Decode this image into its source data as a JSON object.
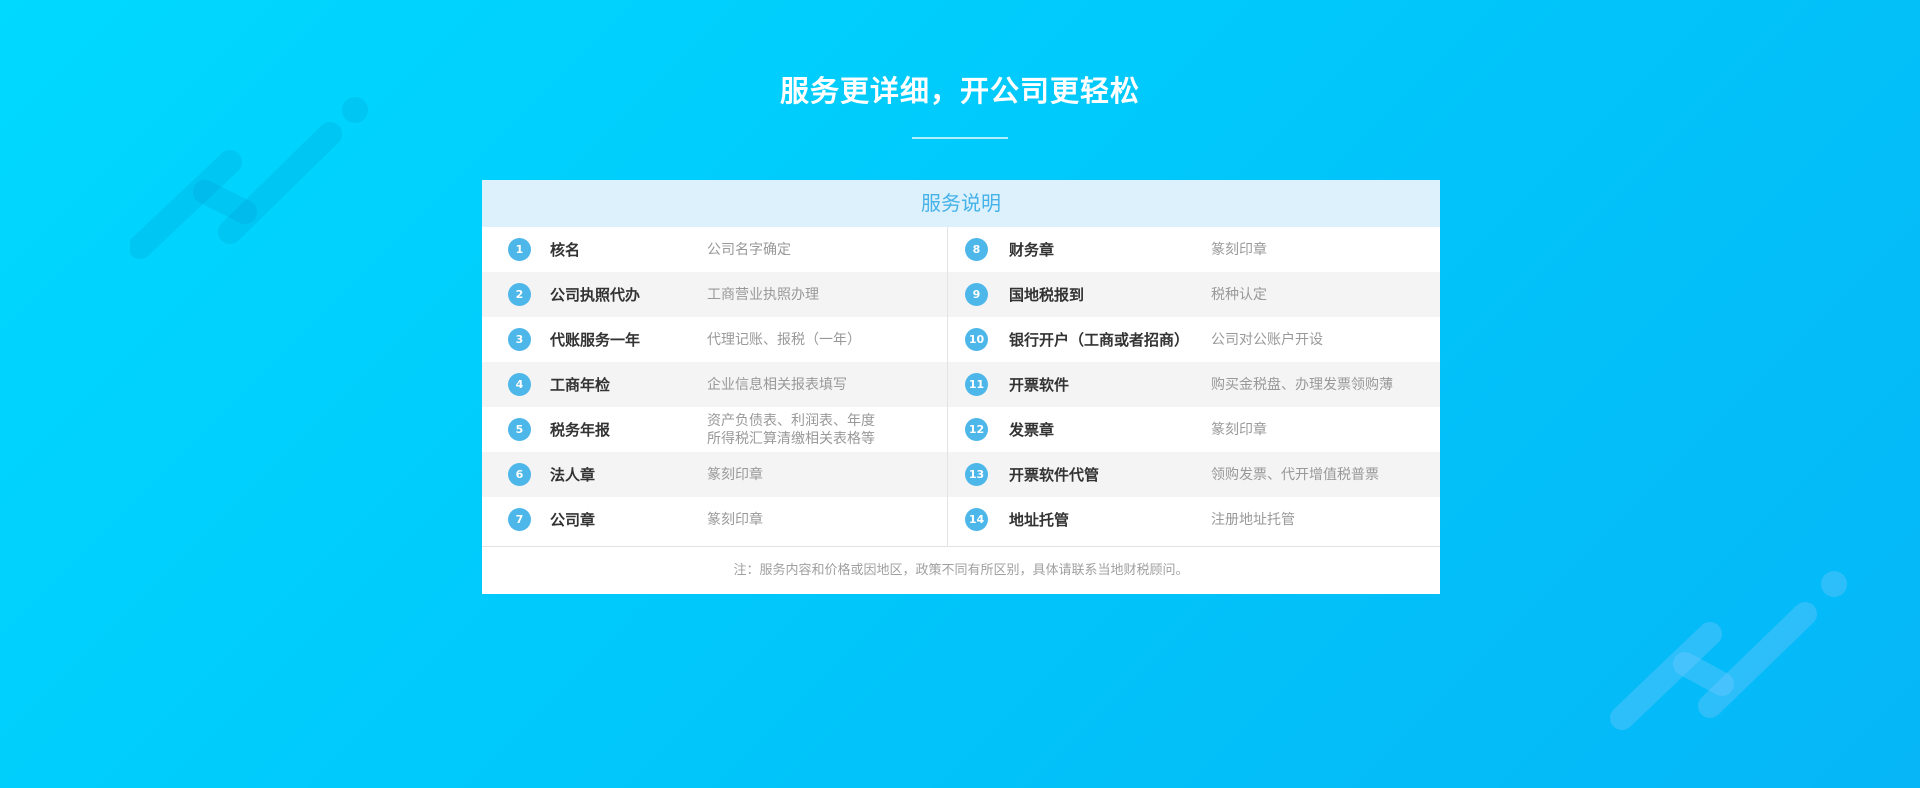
{
  "page": {
    "title": "服务更详细，开公司更轻松"
  },
  "card": {
    "header": "服务说明",
    "footnote": "注：服务内容和价格或因地区，政策不同有所区别，具体请联系当地财税顾问。",
    "left_items": [
      {
        "num": "1",
        "name": "核名",
        "desc": [
          "公司名字确定"
        ]
      },
      {
        "num": "2",
        "name": "公司执照代办",
        "desc": [
          "工商营业执照办理"
        ]
      },
      {
        "num": "3",
        "name": "代账服务一年",
        "desc": [
          "代理记账、报税（一年）"
        ]
      },
      {
        "num": "4",
        "name": "工商年检",
        "desc": [
          "企业信息相关报表填写"
        ]
      },
      {
        "num": "5",
        "name": "税务年报",
        "desc": [
          "资产负债表、利润表、年度",
          "所得税汇算清缴相关表格等"
        ]
      },
      {
        "num": "6",
        "name": "法人章",
        "desc": [
          "篆刻印章"
        ]
      },
      {
        "num": "7",
        "name": "公司章",
        "desc": [
          "篆刻印章"
        ]
      }
    ],
    "right_items": [
      {
        "num": "8",
        "name": "财务章",
        "desc": [
          "篆刻印章"
        ]
      },
      {
        "num": "9",
        "name": "国地税报到",
        "desc": [
          "税种认定"
        ]
      },
      {
        "num": "10",
        "name": "银行开户（工商或者招商）",
        "desc": [
          "公司对公账户开设"
        ]
      },
      {
        "num": "11",
        "name": "开票软件",
        "desc": [
          "购买金税盘、办理发票领购薄"
        ]
      },
      {
        "num": "12",
        "name": "发票章",
        "desc": [
          "篆刻印章"
        ]
      },
      {
        "num": "13",
        "name": "开票软件代管",
        "desc": [
          "领购发票、代开增值税普票"
        ]
      },
      {
        "num": "14",
        "name": "地址托管",
        "desc": [
          "注册地址托管"
        ]
      }
    ]
  },
  "colors": {
    "background_start": "#00d9ff",
    "background_end": "#06b6f7",
    "accent": "#4db7ea",
    "header_bg": "#dcf1fb",
    "header_text": "#46b2ea"
  }
}
